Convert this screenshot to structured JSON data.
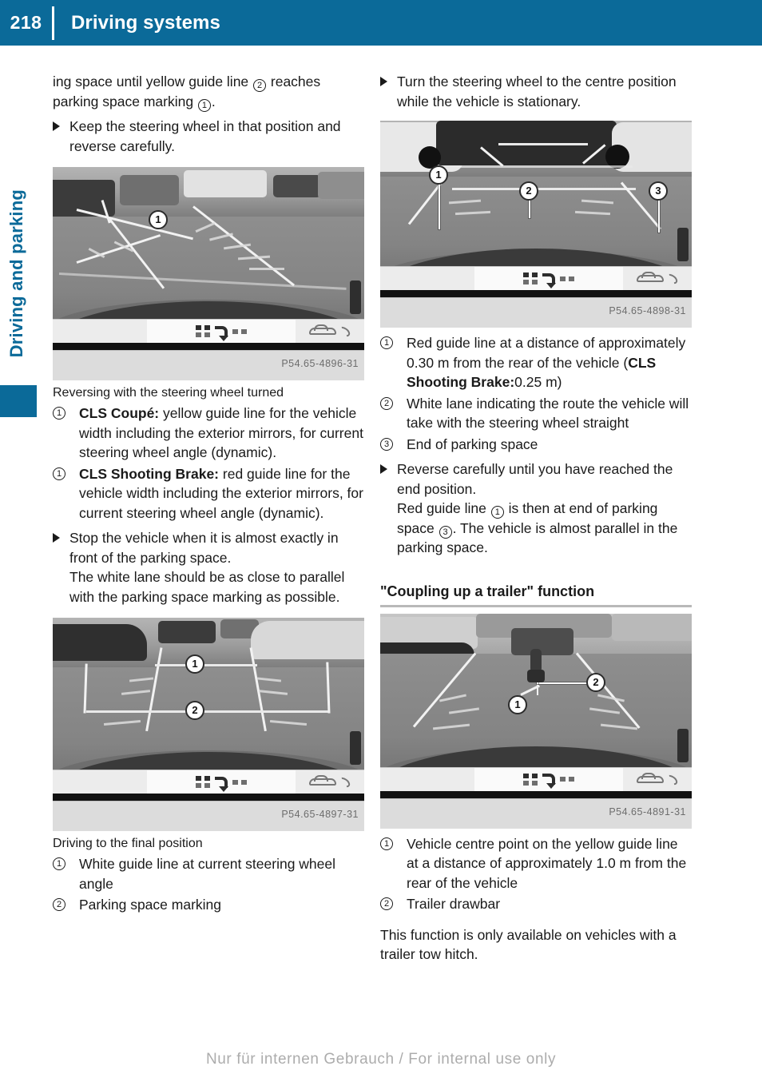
{
  "header": {
    "page_number": "218",
    "title": "Driving systems"
  },
  "side_tab": {
    "label": "Driving and parking"
  },
  "left_column": {
    "para_continued": "ing space until yellow guide line ② reaches parking space marking ①.",
    "para_continued_a": "ing space until yellow guide line ",
    "para_continued_ref1": "2",
    "para_continued_b": " reaches parking space marking ",
    "para_continued_ref2": "1",
    "para_continued_c": ".",
    "bullet_keep_wheel": "Keep the steering wheel in that position and reverse carefully.",
    "figure1": {
      "caption": "Reversing with the steering wheel turned",
      "image_id": "P54.65-4896-31",
      "callouts": [
        "1"
      ]
    },
    "item_cls_coupe_num": "1",
    "item_cls_coupe_bold": "CLS Coupé:",
    "item_cls_coupe_text": " yellow guide line for the vehicle width including the exterior mirrors, for current steering wheel angle (dynamic).",
    "item_cls_brake_num": "1",
    "item_cls_brake_bold": "CLS Shooting Brake:",
    "item_cls_brake_text": " red guide line for the vehicle width including the exterior mirrors, for current steering wheel angle (dynamic).",
    "bullet_stop_vehicle": "Stop the vehicle when it is almost exactly in front of the parking space.",
    "bullet_stop_vehicle_cont": "The white lane should be as close to parallel with the parking space marking as possible.",
    "figure2": {
      "caption": "Driving to the final position",
      "image_id": "P54.65-4897-31",
      "callouts": [
        "1",
        "2"
      ]
    },
    "legend2": [
      {
        "num": "1",
        "text": "White guide line at current steering wheel angle"
      },
      {
        "num": "2",
        "text": "Parking space marking"
      }
    ]
  },
  "right_column": {
    "bullet_turn_wheel": "Turn the steering wheel to the centre position while the vehicle is stationary.",
    "figure3": {
      "image_id": "P54.65-4898-31",
      "callouts": [
        "1",
        "2",
        "3"
      ]
    },
    "legend3_item1_num": "1",
    "legend3_item1_a": "Red guide line at a distance of approximately 0.30 m from the rear of the vehicle (",
    "legend3_item1_bold": "CLS Shooting Brake:",
    "legend3_item1_b": "0.25 m)",
    "legend3_item2_num": "2",
    "legend3_item2_text": "White lane indicating the route the vehicle will take with the steering wheel straight",
    "legend3_item3_num": "3",
    "legend3_item3_text": "End of parking space",
    "bullet_reverse": "Reverse carefully until you have reached the end position.",
    "bullet_reverse_cont_a": "Red guide line ",
    "bullet_reverse_ref1": "1",
    "bullet_reverse_cont_b": " is then at end of parking space ",
    "bullet_reverse_ref2": "3",
    "bullet_reverse_cont_c": ". The vehicle is almost parallel in the parking space.",
    "section_heading": "\"Coupling up a trailer\" function",
    "figure4": {
      "image_id": "P54.65-4891-31",
      "callouts": [
        "1",
        "2"
      ]
    },
    "legend4": [
      {
        "num": "1",
        "text": "Vehicle centre point on the yellow guide line at a distance of approximately 1.0 m from the rear of the vehicle"
      },
      {
        "num": "2",
        "text": "Trailer drawbar"
      }
    ],
    "closing_note": "This function is only available on vehicles with a trailer tow hitch."
  },
  "footer": {
    "watermark": "Nur für internen Gebrauch / For internal use only"
  },
  "colors": {
    "brand_blue": "#0b6a99",
    "rule_gray": "#b9b9b9",
    "text": "#1a1a1a",
    "watermark": "#9a9a9a"
  }
}
